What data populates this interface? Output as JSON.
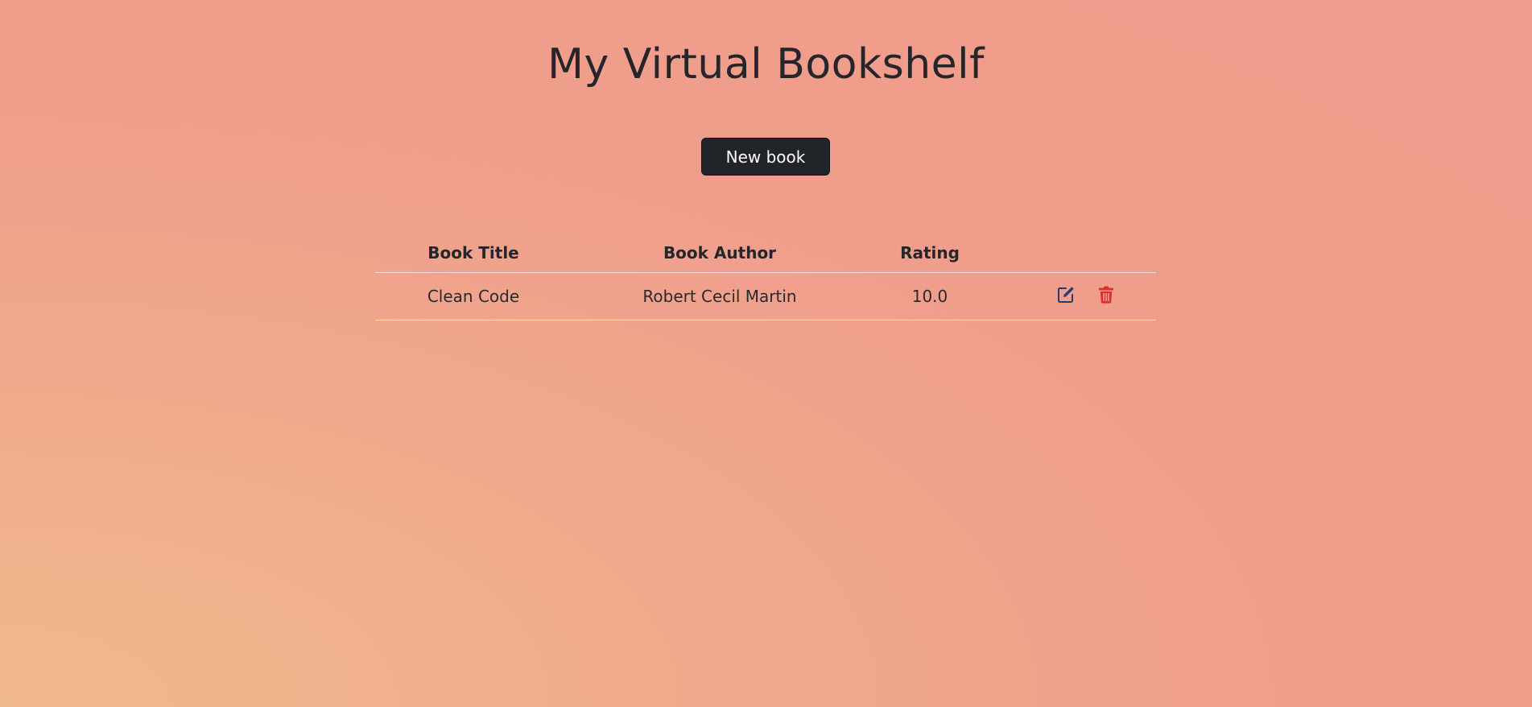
{
  "header": {
    "title": "My Virtual Bookshelf"
  },
  "toolbar": {
    "new_book_label": "New book"
  },
  "table": {
    "columns": [
      "Book Title",
      "Book Author",
      "Rating",
      ""
    ],
    "rows": [
      {
        "title": "Clean Code",
        "author": "Robert Cecil Martin",
        "rating": "10.0",
        "edit_icon": "edit-icon",
        "delete_icon": "trash-icon"
      }
    ]
  },
  "colors": {
    "button_bg": "#212429",
    "edit_icon": "#2b3a6b",
    "delete_icon": "#d9322f",
    "background_start": "#f0b98c",
    "background_end": "#f09c8c"
  }
}
